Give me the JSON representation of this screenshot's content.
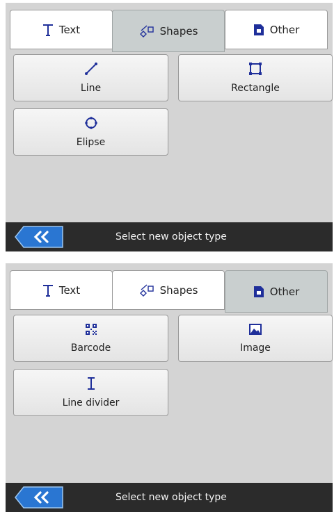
{
  "panels": [
    {
      "tabs": [
        {
          "label": "Text",
          "icon": "text-icon",
          "active": false
        },
        {
          "label": "Shapes",
          "icon": "shapes-icon",
          "active": true
        },
        {
          "label": "Other",
          "icon": "document-icon",
          "active": false
        }
      ],
      "buttons": [
        {
          "label": "Line",
          "icon": "line-icon"
        },
        {
          "label": "Rectangle",
          "icon": "rectangle-icon"
        },
        {
          "label": "Elipse",
          "icon": "ellipse-icon"
        }
      ],
      "status": "Select new object type",
      "back_icon": "double-chevron-left-icon"
    },
    {
      "tabs": [
        {
          "label": "Text",
          "icon": "text-icon",
          "active": false
        },
        {
          "label": "Shapes",
          "icon": "shapes-icon",
          "active": false
        },
        {
          "label": "Other",
          "icon": "document-icon",
          "active": true
        }
      ],
      "buttons": [
        {
          "label": "Barcode",
          "icon": "qr-code-icon"
        },
        {
          "label": "Image",
          "icon": "image-icon"
        },
        {
          "label": "Line divider",
          "icon": "line-divider-icon"
        }
      ],
      "status": "Select new object type",
      "back_icon": "double-chevron-left-icon"
    }
  ],
  "colors": {
    "accent": "#1f2f9a",
    "panel_bg": "#d4d4d4",
    "status_bg": "#2b2b2b",
    "active_tab": "#c9cfcf",
    "back_button": "#2a76d2"
  }
}
